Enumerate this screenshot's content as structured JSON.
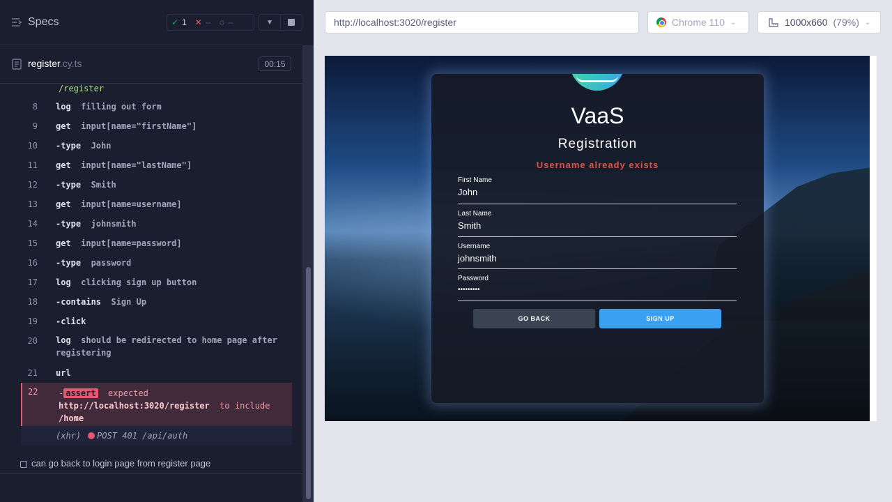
{
  "reporter": {
    "specs_title": "Specs",
    "stats": {
      "passed": "1",
      "failed": "--",
      "pending": "--"
    },
    "file": {
      "name": "register",
      "ext": ".cy.ts",
      "duration": "00:15"
    },
    "visit_url": "/register",
    "commands": [
      {
        "num": "8",
        "name": "log",
        "msg": "filling out form"
      },
      {
        "num": "9",
        "name": "get",
        "msg": "input[name=\"firstName\"]"
      },
      {
        "num": "10",
        "name": "-type",
        "msg": "John"
      },
      {
        "num": "11",
        "name": "get",
        "msg": "input[name=\"lastName\"]"
      },
      {
        "num": "12",
        "name": "-type",
        "msg": "Smith"
      },
      {
        "num": "13",
        "name": "get",
        "msg": "input[name=username]"
      },
      {
        "num": "14",
        "name": "-type",
        "msg": "johnsmith"
      },
      {
        "num": "15",
        "name": "get",
        "msg": "input[name=password]"
      },
      {
        "num": "16",
        "name": "-type",
        "msg": "password"
      },
      {
        "num": "17",
        "name": "log",
        "msg": "clicking sign up button"
      },
      {
        "num": "18",
        "name": "-contains",
        "msg": "Sign Up"
      },
      {
        "num": "19",
        "name": "-click",
        "msg": ""
      },
      {
        "num": "20",
        "name": "log",
        "msg": "should be redirected to home page after registering"
      },
      {
        "num": "21",
        "name": "url",
        "msg": ""
      }
    ],
    "assert": {
      "num": "22",
      "prefix": "-",
      "badge": "assert",
      "expected": "expected",
      "url": "http://localhost:3020/register",
      "to_include": "to include",
      "target": "/home"
    },
    "xhr": {
      "label": "(xhr)",
      "request": "POST 401 /api/auth"
    },
    "next_test": "can go back to login page from register page"
  },
  "browser": {
    "url": "http://localhost:3020/register",
    "browser_name": "Chrome 110",
    "viewport": "1000x660",
    "zoom": "(79%)"
  },
  "app": {
    "title": "VaaS",
    "page_title": "Registration",
    "error": "Username already exists",
    "fields": [
      {
        "label": "First Name",
        "value": "John"
      },
      {
        "label": "Last Name",
        "value": "Smith"
      },
      {
        "label": "Username",
        "value": "johnsmith"
      },
      {
        "label": "Password",
        "value": "•••••••••"
      }
    ],
    "go_back": "GO BACK",
    "sign_up": "SIGN UP"
  }
}
